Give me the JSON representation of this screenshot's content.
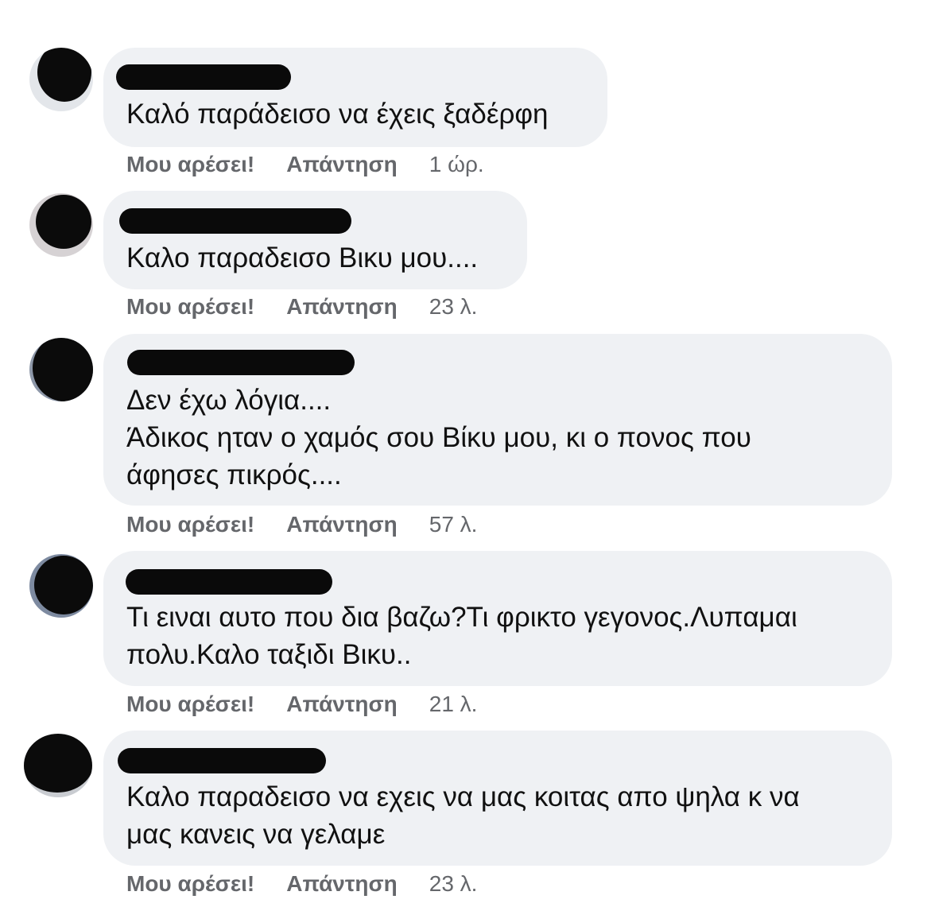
{
  "actions": {
    "like_label": "Μου αρέσει!",
    "reply_label": "Απάντηση"
  },
  "comments": [
    {
      "text": "Καλό παράδεισο να έχεις ξαδέρφη",
      "time": "1 ώρ."
    },
    {
      "text": "Καλο παραδεισο Βικυ μου....",
      "time": "23 λ."
    },
    {
      "text": "Δεν έχω λόγια....\nΆδικος ηταν ο χαμός σου Βίκυ μου, κι ο πονος που\nάφησες πικρός....",
      "time": "57 λ."
    },
    {
      "text": "Τι ειναι αυτο που δια βαζω?Τι φρικτο γεγονος.Λυπαμαι\nπολυ.Καλο ταξιδι Βικυ..",
      "time": "21 λ."
    },
    {
      "text": "Καλο παραδεισο να εχεις να μας κοιτας απο ψηλα κ να\nμας κανεις να γελαμε",
      "time": "23 λ."
    }
  ]
}
